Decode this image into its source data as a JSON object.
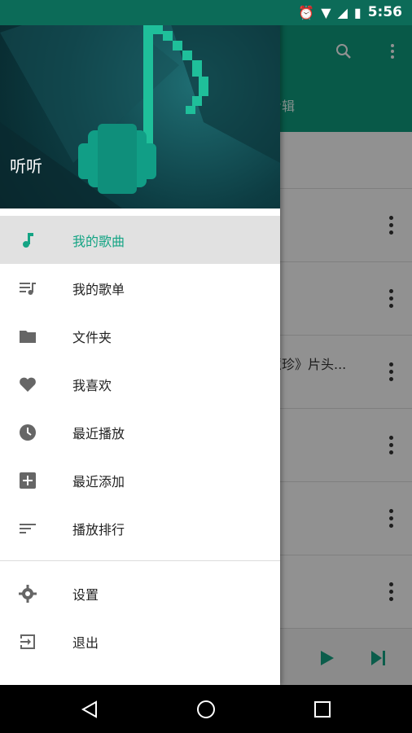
{
  "status_bar": {
    "time": "5:56"
  },
  "drawer": {
    "header_name": "听听",
    "menu_items": [
      {
        "label": "我的歌曲",
        "icon": "music-note-icon"
      },
      {
        "label": "我的歌单",
        "icon": "playlist-icon"
      },
      {
        "label": "文件夹",
        "icon": "folder-icon"
      },
      {
        "label": "我喜欢",
        "icon": "heart-icon"
      },
      {
        "label": "最近播放",
        "icon": "clock-icon"
      },
      {
        "label": "最近添加",
        "icon": "add-box-icon"
      },
      {
        "label": "播放排行",
        "icon": "sort-icon"
      }
    ],
    "secondary_items": [
      {
        "label": "设置",
        "icon": "settings-icon"
      },
      {
        "label": "退出",
        "icon": "exit-icon"
      }
    ]
  },
  "background": {
    "tab_partial": "专辑",
    "row_text_partial": "慧珍》片头..."
  },
  "colors": {
    "accent": "#14a484",
    "toolbar": "#0f9d7f"
  }
}
